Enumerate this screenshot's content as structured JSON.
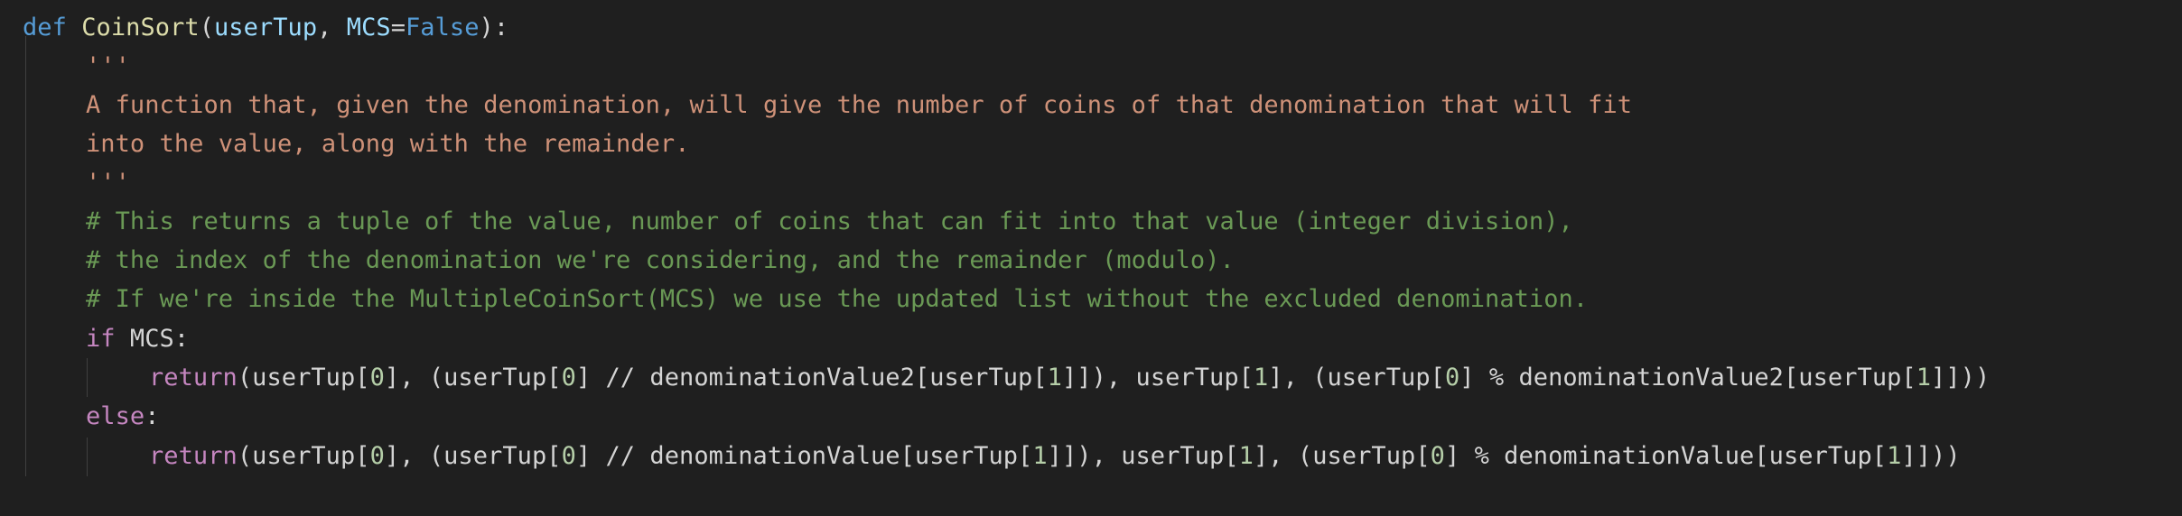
{
  "code": {
    "line1": {
      "def": "def",
      "name": "CoinSort",
      "p_open": "(",
      "param1": "userTup",
      "comma": ", ",
      "param2": "MCS",
      "eq": "=",
      "default": "False",
      "p_close": "):"
    },
    "line2": {
      "text": "'''"
    },
    "line3": {
      "text": "A function that, given the denomination, will give the number of coins of that denomination that will fit"
    },
    "line4": {
      "text": "into the value, along with the remainder."
    },
    "line5": {
      "text": "'''"
    },
    "line6": {
      "text": "# This returns a tuple of the value, number of coins that can fit into that value (integer division),"
    },
    "line7": {
      "text": "# the index of the denomination we're considering, and the remainder (modulo)."
    },
    "line8": {
      "text": "# If we're inside the MultipleCoinSort(MCS) we use the updated list without the excluded denomination."
    },
    "line9": {
      "kw": "if",
      "rest": " MCS:"
    },
    "line10": {
      "kw": "return",
      "a": "(userTup[",
      "n1": "0",
      "b": "], (userTup[",
      "n2": "0",
      "c": "] // denominationValue2[userTup[",
      "n3": "1",
      "d": "]]), userTup[",
      "n4": "1",
      "e": "], (userTup[",
      "n5": "0",
      "f": "] % denominationValue2[userTup[",
      "n6": "1",
      "g": "]]))"
    },
    "line11": {
      "kw": "else",
      "rest": ":"
    },
    "line12": {
      "kw": "return",
      "a": "(userTup[",
      "n1": "0",
      "b": "], (userTup[",
      "n2": "0",
      "c": "] // denominationValue[userTup[",
      "n3": "1",
      "d": "]]), userTup[",
      "n4": "1",
      "e": "], (userTup[",
      "n5": "0",
      "f": "] % denominationValue[userTup[",
      "n6": "1",
      "g": "]]))"
    }
  },
  "theme": {
    "background": "#1f1f1f",
    "keyword": "#569cd6",
    "function": "#dcdcaa",
    "parameter": "#9cdcfe",
    "control": "#c586c0",
    "string": "#ce9178",
    "comment": "#6a9955",
    "number": "#b5cea8",
    "text": "#d4d4d4"
  }
}
